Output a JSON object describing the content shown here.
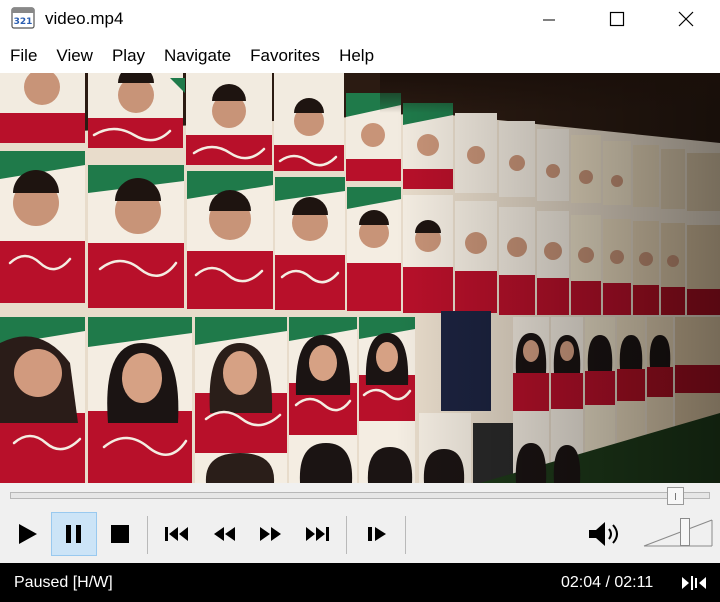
{
  "window": {
    "title": "video.mp4",
    "icon": "film-321-icon",
    "controls": [
      "minimize-icon",
      "maximize-icon",
      "close-icon"
    ]
  },
  "menu": {
    "items": [
      "File",
      "View",
      "Play",
      "Navigate",
      "Favorites",
      "Help"
    ]
  },
  "seek": {
    "progress": 0.95
  },
  "toolbar": {
    "buttons": [
      "play-icon",
      "pause-icon",
      "stop-icon",
      "skip-back-icon",
      "rewind-icon",
      "fast-forward-icon",
      "skip-forward-icon",
      "frame-step-icon"
    ],
    "pressed": "pause-icon",
    "volume_icon": "speaker-icon",
    "volume_level": 0.62
  },
  "status": {
    "state": "Paused [H/W]",
    "time": "02:04 / 02:11",
    "icon": "signal-icon"
  },
  "colors": {
    "accent": "#cce4f7",
    "statusbar": "#000000",
    "poster_green": "#1f7a4a",
    "poster_red": "#b8102a"
  }
}
